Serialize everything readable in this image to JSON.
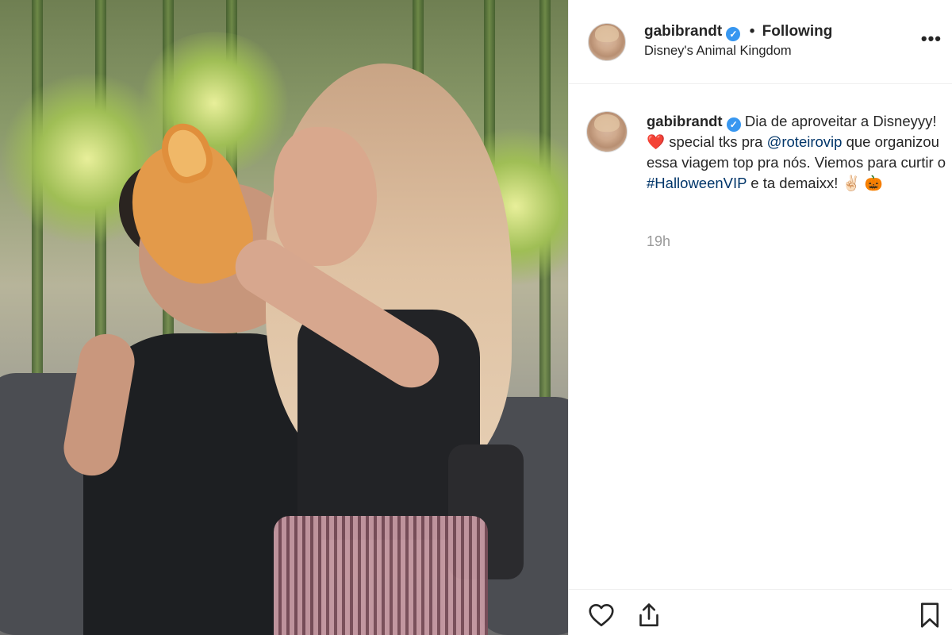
{
  "post": {
    "username": "gabibrandt",
    "follow_separator": "•",
    "follow_status": "Following",
    "location": "Disney's Animal Kingdom",
    "more_label": "•••"
  },
  "caption": {
    "username": "gabibrandt",
    "text_1": "Dia de aproveitar a Disneyyy!",
    "emoji_heart": "❤️",
    "text_2": " special tks pra",
    "mention": "@roteirovip",
    "text_3": " que organizou essa viagem top pra nós. Viemos para curtir o ",
    "hashtag": "#HalloweenVIP",
    "text_4": " e ta demaixx!",
    "emoji_victory": "✌🏻",
    "emoji_pumpkin": "🎃",
    "time": "19h"
  },
  "icons": {
    "verified": "verified-badge-icon",
    "like": "heart-outline-icon",
    "share": "share-icon",
    "save": "bookmark-icon"
  },
  "colors": {
    "verified_blue": "#3897f0",
    "link_blue": "#003569",
    "muted_gray": "#999999",
    "heart_red": "#e0245e"
  }
}
